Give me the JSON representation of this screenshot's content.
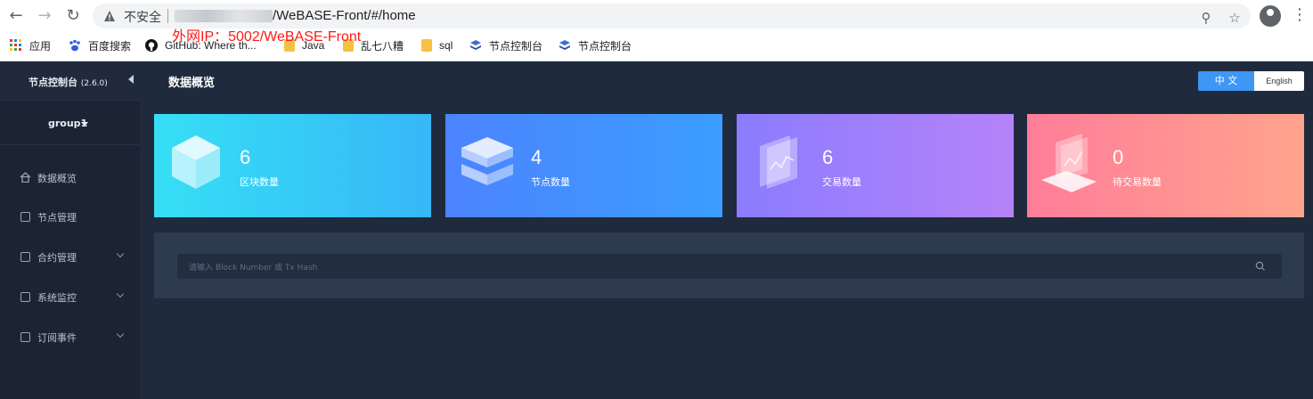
{
  "browser": {
    "insecure_label": "不安全",
    "url": "/WeBASE-Front/#/home",
    "bookmarks": [
      {
        "label": "应用",
        "icon": "apps-grid-icon"
      },
      {
        "label": "百度搜索",
        "icon": "baidu-paw-icon"
      },
      {
        "label": "GitHub: Where th...",
        "icon": "github-icon"
      },
      {
        "label": "Java",
        "icon": "folder-icon"
      },
      {
        "label": "乱七八糟",
        "icon": "folder-icon"
      },
      {
        "label": "sql",
        "icon": "folder-icon"
      },
      {
        "label": "节点控制台",
        "icon": "layers-icon"
      },
      {
        "label": "节点控制台",
        "icon": "layers-icon"
      }
    ]
  },
  "overlay": {
    "ip_text": "外网IP：5002/WeBASE-Front"
  },
  "sidebar": {
    "title": "节点控制台",
    "version": "(2.6.0)",
    "group": "group1",
    "items": [
      {
        "label": "数据概览",
        "icon": "home-icon"
      },
      {
        "label": "节点管理",
        "icon": "calendar-icon"
      },
      {
        "label": "合约管理",
        "icon": "clipboard-icon"
      },
      {
        "label": "系统监控",
        "icon": "monitor-icon"
      },
      {
        "label": "订阅事件",
        "icon": "rss-icon"
      }
    ]
  },
  "main": {
    "title": "数据概览",
    "lang_zh": "中 文",
    "lang_en": "English",
    "cards": [
      {
        "value": "6",
        "label": "区块数量",
        "colors": [
          "#36dff5",
          "#37b7f7"
        ]
      },
      {
        "value": "4",
        "label": "节点数量",
        "colors": [
          "#4c84ff",
          "#3b9dff"
        ]
      },
      {
        "value": "6",
        "label": "交易数量",
        "colors": [
          "#8b7cff",
          "#b583f8"
        ]
      },
      {
        "value": "0",
        "label": "待交易数量",
        "colors": [
          "#ff7d99",
          "#ffa48c"
        ]
      }
    ],
    "search_placeholder": "请输入 Block Number 或 Tx Hash"
  }
}
